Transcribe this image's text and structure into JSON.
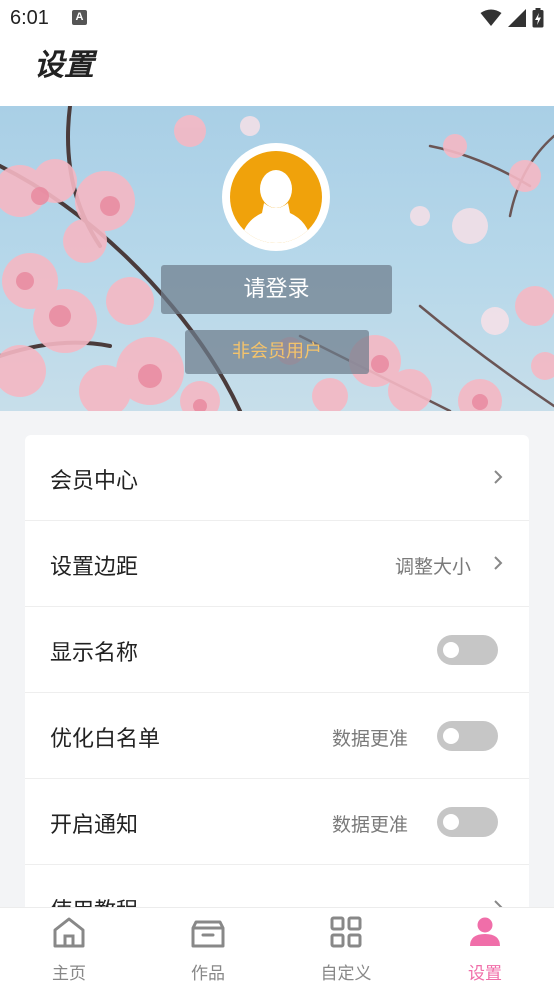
{
  "status_bar": {
    "time": "6:01",
    "notification_letter": "A"
  },
  "header": {
    "title": "设置"
  },
  "profile": {
    "login_label": "请登录",
    "membership_status": "非会员用户"
  },
  "settings": [
    {
      "label": "会员中心",
      "hint": "",
      "control": "chevron"
    },
    {
      "label": "设置边距",
      "hint": "调整大小",
      "control": "chevron"
    },
    {
      "label": "显示名称",
      "hint": "",
      "control": "toggle",
      "on": false
    },
    {
      "label": "优化白名单",
      "hint": "数据更准",
      "control": "toggle",
      "on": false
    },
    {
      "label": "开启通知",
      "hint": "数据更准",
      "control": "toggle",
      "on": false
    },
    {
      "label": "使用教程",
      "hint": "",
      "control": "chevron"
    }
  ],
  "tabbar": {
    "items": [
      {
        "label": "主页",
        "icon": "home-icon",
        "active": false
      },
      {
        "label": "作品",
        "icon": "archive-box-icon",
        "active": false
      },
      {
        "label": "自定义",
        "icon": "grid-icon",
        "active": false
      },
      {
        "label": "设置",
        "icon": "user-icon",
        "active": true
      }
    ]
  },
  "colors": {
    "accent": "#f06ea9",
    "avatar_bg": "#f0a20b",
    "member_text": "#f4c36b",
    "toggle_off": "#c6c6c6"
  }
}
